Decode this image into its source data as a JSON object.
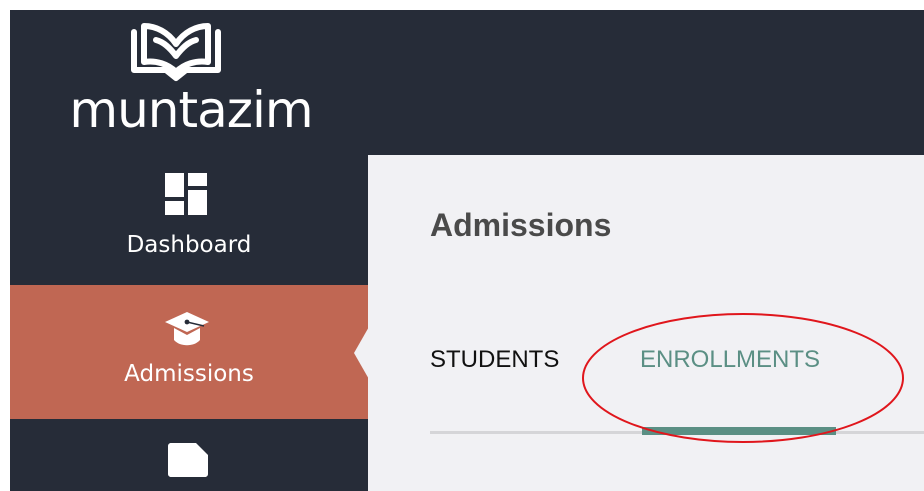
{
  "app": {
    "name": "muntazim"
  },
  "sidebar": {
    "items": [
      {
        "label": "Dashboard",
        "icon": "dashboard-grid-icon",
        "active": false
      },
      {
        "label": "Admissions",
        "icon": "graduation-cap-icon",
        "active": true
      },
      {
        "label": "",
        "icon": "document-icon",
        "active": false
      }
    ]
  },
  "page": {
    "title": "Admissions"
  },
  "tabs": [
    {
      "label": "STUDENTS",
      "active": false
    },
    {
      "label": "ENROLLMENTS",
      "active": true
    }
  ],
  "colors": {
    "sidebar_bg": "#262c38",
    "active_item_bg": "#c06753",
    "content_bg": "#f1f1f4",
    "tab_accent": "#5b8f84",
    "annotation": "#e0161c"
  }
}
